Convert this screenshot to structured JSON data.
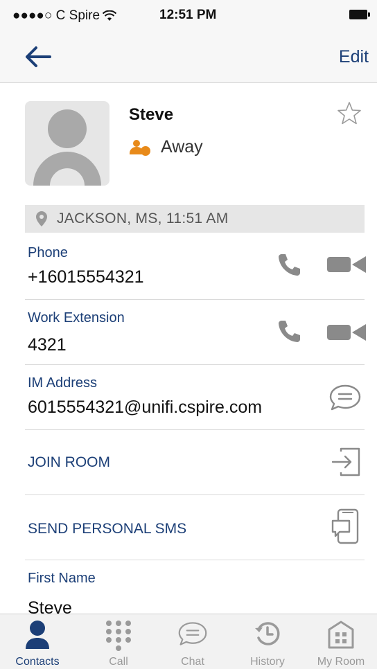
{
  "status_bar": {
    "carrier": "●●●●○ C Spire",
    "time": "12:51 PM"
  },
  "nav": {
    "edit_label": "Edit"
  },
  "contact": {
    "name": "Steve",
    "presence": "Away",
    "location": "JACKSON, MS, 11:51 AM"
  },
  "details": [
    {
      "label": "Phone",
      "value": "+16015554321"
    },
    {
      "label": "Work Extension",
      "value": "4321"
    },
    {
      "label": "IM Address",
      "value": "6015554321@unifi.cspire.com"
    },
    {
      "label": "First Name",
      "value": "Steve"
    }
  ],
  "actions": {
    "join_room": "JOIN ROOM",
    "send_sms": "SEND PERSONAL SMS"
  },
  "tabs": [
    {
      "label": "Contacts",
      "icon": "contacts-icon"
    },
    {
      "label": "Call",
      "icon": "dialpad-icon"
    },
    {
      "label": "Chat",
      "icon": "chat-icon"
    },
    {
      "label": "History",
      "icon": "history-icon"
    },
    {
      "label": "My Room",
      "icon": "my-room-icon"
    }
  ],
  "colors": {
    "accent": "#1c3f77",
    "presence_away": "#e88a1a",
    "icon_gray": "#8a8a8a"
  }
}
